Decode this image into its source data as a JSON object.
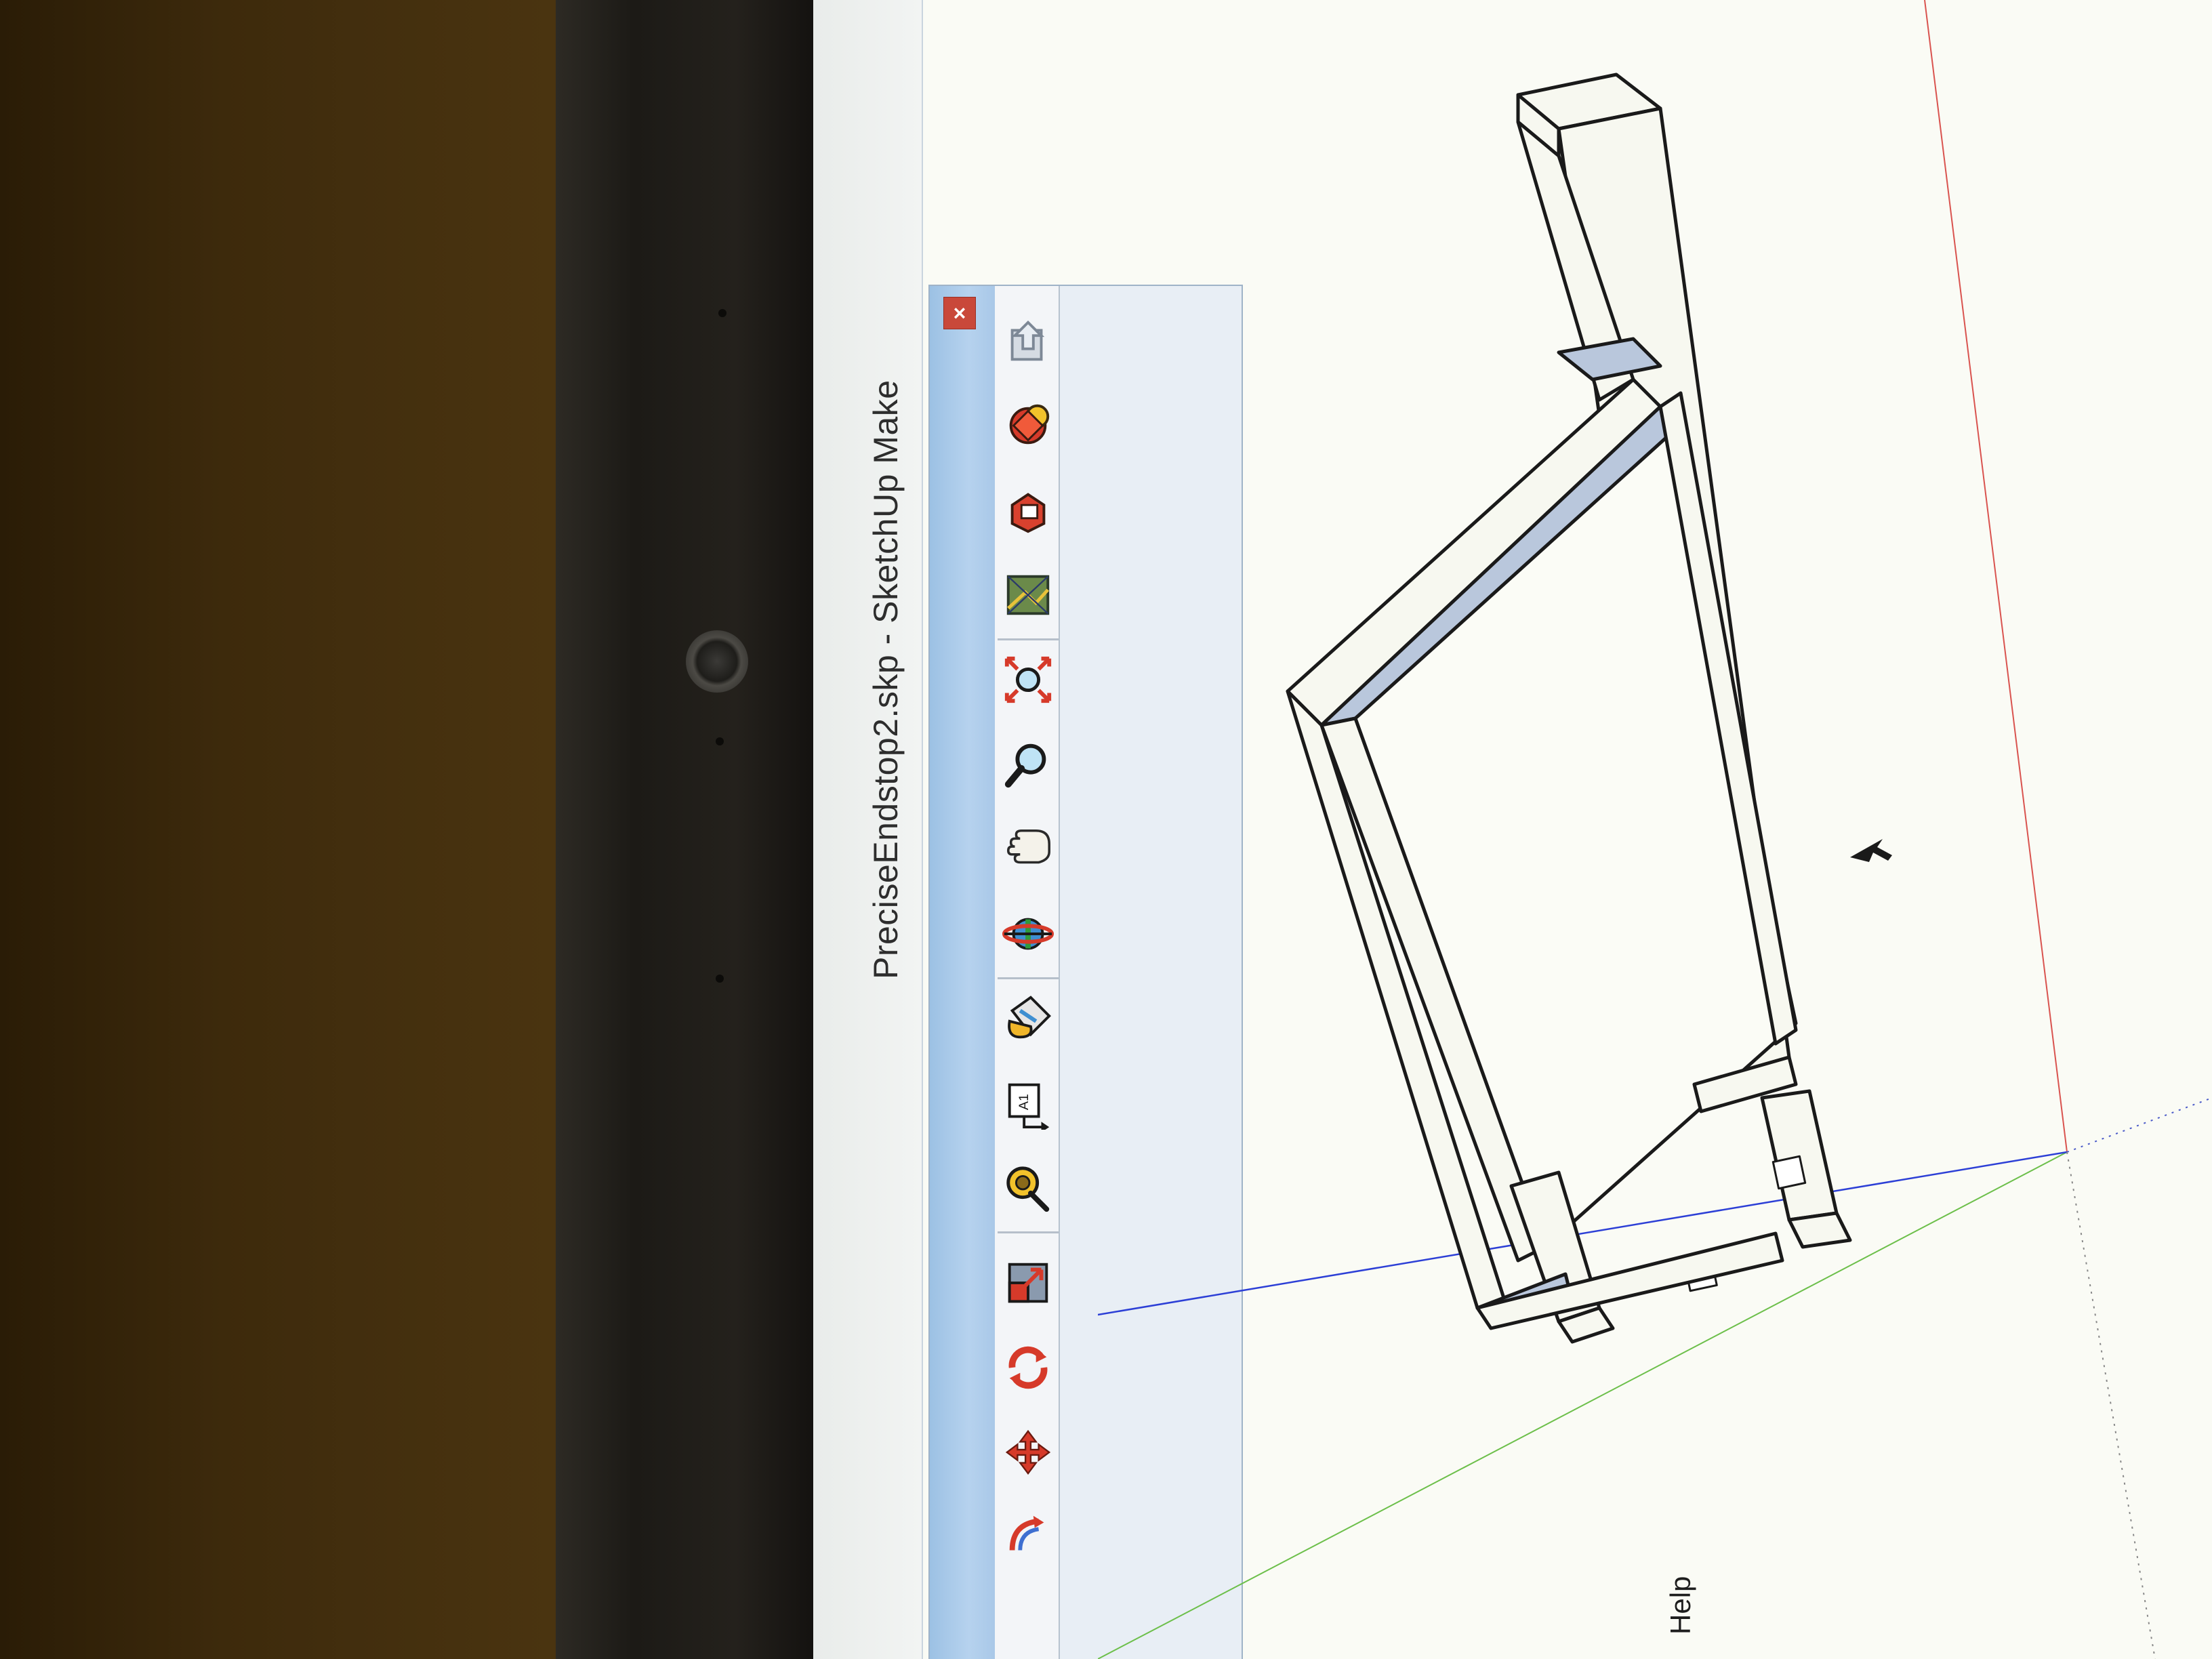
{
  "window": {
    "title": "PreciseEndstop2.skp - SketchUp Make"
  },
  "menu": {
    "help_label": "Help"
  },
  "toolbar": {
    "close_glyph": "×",
    "buttons": [
      {
        "name": "3d-warehouse-share-icon"
      },
      {
        "name": "extension-warehouse-icon"
      },
      {
        "name": "layout-send-icon"
      },
      {
        "name": "photo-match-icon"
      },
      {
        "name": "zoom-extents-icon"
      },
      {
        "name": "zoom-icon"
      },
      {
        "name": "pan-hand-icon"
      },
      {
        "name": "orbit-icon"
      },
      {
        "name": "paint-bucket-icon"
      },
      {
        "name": "text-tool-icon"
      },
      {
        "name": "tape-measure-icon"
      },
      {
        "name": "scale-icon"
      },
      {
        "name": "rotate-icon"
      },
      {
        "name": "move-icon"
      },
      {
        "name": "follow-me-icon"
      }
    ]
  },
  "colors": {
    "axis_red": "#d9534f",
    "axis_green": "#6cbf4a",
    "axis_blue": "#2c3fd6",
    "model_face": "#f7f8f0",
    "model_shadow_face": "#b9c7dc",
    "model_edge": "#1a1a1a"
  }
}
